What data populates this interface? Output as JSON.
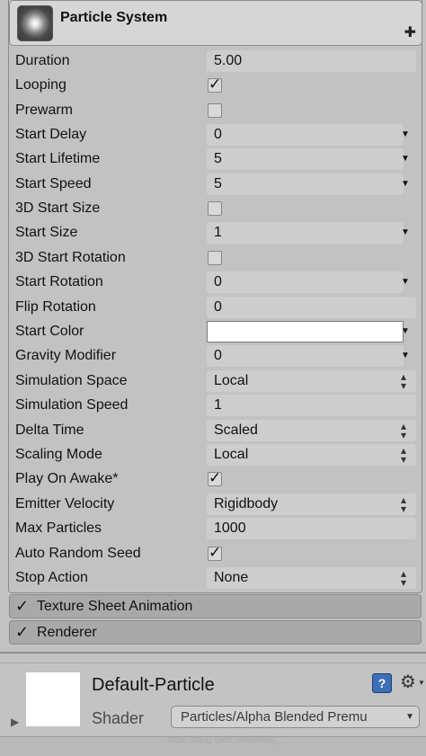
{
  "header": {
    "title": "Particle System"
  },
  "rows": [
    {
      "label": "Duration",
      "value": "5.00"
    },
    {
      "label": "Looping",
      "checked": true
    },
    {
      "label": "Prewarm",
      "checked": false
    },
    {
      "label": "Start Delay",
      "value": "0"
    },
    {
      "label": "Start Lifetime",
      "value": "5"
    },
    {
      "label": "Start Speed",
      "value": "5"
    },
    {
      "label": "3D Start Size",
      "checked": false
    },
    {
      "label": "Start Size",
      "value": "1"
    },
    {
      "label": "3D Start Rotation",
      "checked": false
    },
    {
      "label": "Start Rotation",
      "value": "0"
    },
    {
      "label": "Flip Rotation",
      "value": "0"
    },
    {
      "label": "Start Color",
      "color": "#ffffff"
    },
    {
      "label": "Gravity Modifier",
      "value": "0"
    },
    {
      "label": "Simulation Space",
      "value": "Local"
    },
    {
      "label": "Simulation Speed",
      "value": "1"
    },
    {
      "label": "Delta Time",
      "value": "Scaled"
    },
    {
      "label": "Scaling Mode",
      "value": "Local"
    },
    {
      "label": "Play On Awake*",
      "checked": true
    },
    {
      "label": "Emitter Velocity",
      "value": "Rigidbody"
    },
    {
      "label": "Max Particles",
      "value": "1000"
    },
    {
      "label": "Auto Random Seed",
      "checked": true
    },
    {
      "label": "Stop Action",
      "value": "None"
    }
  ],
  "modules": [
    {
      "label": "Texture Sheet Animation",
      "enabled": true
    },
    {
      "label": "Renderer",
      "enabled": true
    }
  ],
  "material": {
    "name": "Default-Particle",
    "shader_label": "Shader",
    "shader_value": "Particles/Alpha Blended Premu"
  },
  "watermark": "https://blog.csdn.net/weixin_..."
}
